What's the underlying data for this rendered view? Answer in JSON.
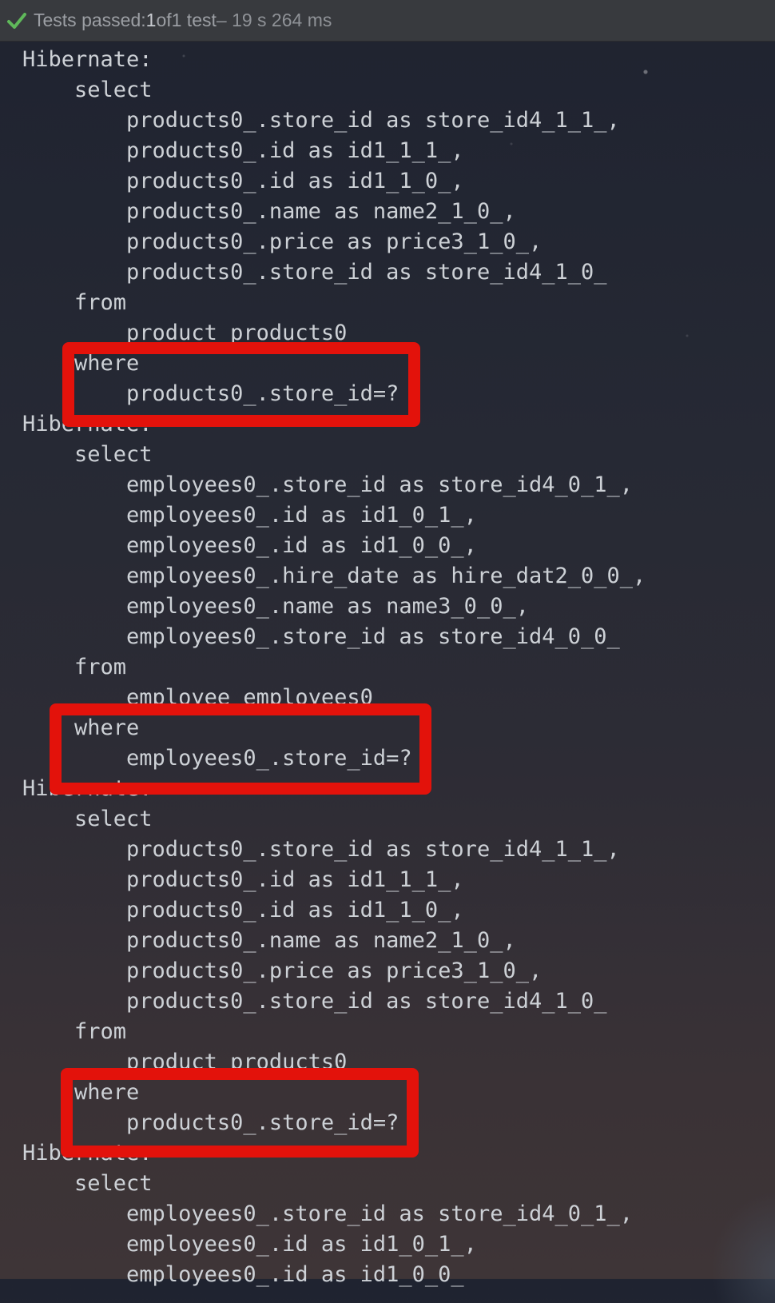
{
  "status": {
    "prefix": "Tests passed: ",
    "count": "1",
    "of_text": " of ",
    "total": "1 test",
    "duration": " – 19 s 264 ms",
    "icon": "check-icon",
    "icon_color": "#5fb85a"
  },
  "console_lines": [
    "Hibernate:",
    "    select",
    "        products0_.store_id as store_id4_1_1_,",
    "        products0_.id as id1_1_1_,",
    "        products0_.id as id1_1_0_,",
    "        products0_.name as name2_1_0_,",
    "        products0_.price as price3_1_0_,",
    "        products0_.store_id as store_id4_1_0_",
    "    from",
    "        product products0",
    "    where",
    "        products0_.store_id=?",
    "Hibernate:",
    "    select",
    "        employees0_.store_id as store_id4_0_1_,",
    "        employees0_.id as id1_0_1_,",
    "        employees0_.id as id1_0_0_,",
    "        employees0_.hire_date as hire_dat2_0_0_,",
    "        employees0_.name as name3_0_0_,",
    "        employees0_.store_id as store_id4_0_0_",
    "    from",
    "        employee employees0",
    "    where",
    "        employees0_.store_id=?",
    "Hibernate:",
    "    select",
    "        products0_.store_id as store_id4_1_1_,",
    "        products0_.id as id1_1_1_,",
    "        products0_.id as id1_1_0_,",
    "        products0_.name as name2_1_0_,",
    "        products0_.price as price3_1_0_,",
    "        products0_.store_id as store_id4_1_0_",
    "    from",
    "        product products0",
    "    where",
    "        products0_.store_id=?",
    "Hibernate:",
    "    select",
    "        employees0_.store_id as store_id4_0_1_,",
    "        employees0_.id as id1_0_1_,",
    "        employees0_.id as id1_0_0_"
  ],
  "highlight_color": "#e3120b"
}
